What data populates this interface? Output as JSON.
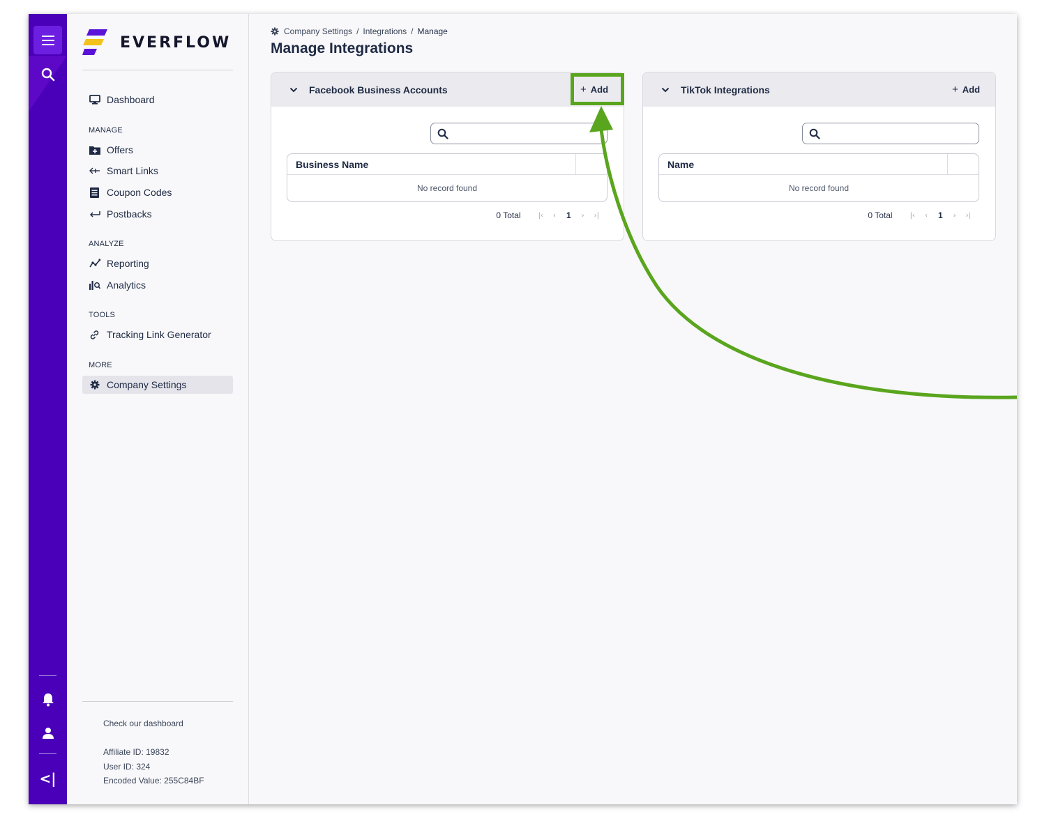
{
  "rail": {
    "icons": [
      "menu-icon",
      "search-icon",
      "bell-icon",
      "user-icon",
      "collapse-icon"
    ],
    "collapse_glyph": "<|",
    "bg": "#4a00b8"
  },
  "sidebar": {
    "logo_text": "EVERFLOW",
    "dashboard": "Dashboard",
    "sections": {
      "manage": "MANAGE",
      "analyze": "ANALYZE",
      "tools": "TOOLS",
      "more": "MORE"
    },
    "items": {
      "offers": "Offers",
      "smart_links": "Smart Links",
      "coupon_codes": "Coupon Codes",
      "postbacks": "Postbacks",
      "reporting": "Reporting",
      "analytics": "Analytics",
      "tracking_link_generator": "Tracking Link Generator",
      "company_settings": "Company Settings"
    },
    "footer": {
      "dashboard_link": "Check our dashboard",
      "affiliate_id": "Affiliate ID: 19832",
      "user_id": "User ID: 324",
      "encoded_value": "Encoded Value: 255C84BF"
    }
  },
  "main": {
    "breadcrumb": {
      "root": "Company Settings",
      "mid": "Integrations",
      "current": "Manage",
      "sep": "/"
    },
    "title": "Manage Integrations",
    "cards": {
      "facebook": {
        "title": "Facebook Business Accounts",
        "add_label": "Add",
        "search_placeholder": "",
        "column": "Business Name",
        "empty_text": "No record found",
        "total": "0 Total",
        "page": "1"
      },
      "tiktok": {
        "title": "TikTok Integrations",
        "add_label": "Add",
        "search_placeholder": "",
        "column": "Name",
        "empty_text": "No record found",
        "total": "0 Total",
        "page": "1"
      }
    }
  },
  "annotation": {
    "highlight_color": "#5aa51e",
    "target": "facebook-add-button"
  }
}
